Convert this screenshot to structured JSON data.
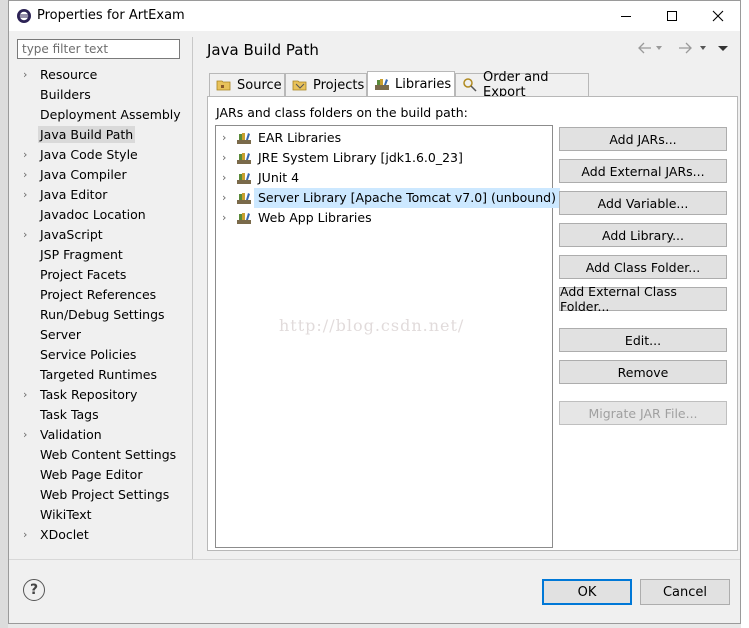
{
  "window": {
    "title": "Properties for ArtExam"
  },
  "filter": {
    "placeholder": "type filter text"
  },
  "nav": [
    {
      "label": "Resource",
      "expandable": true
    },
    {
      "label": "Builders",
      "expandable": false
    },
    {
      "label": "Deployment Assembly",
      "expandable": false
    },
    {
      "label": "Java Build Path",
      "expandable": false,
      "selected": true
    },
    {
      "label": "Java Code Style",
      "expandable": true
    },
    {
      "label": "Java Compiler",
      "expandable": true
    },
    {
      "label": "Java Editor",
      "expandable": true
    },
    {
      "label": "Javadoc Location",
      "expandable": false
    },
    {
      "label": "JavaScript",
      "expandable": true
    },
    {
      "label": "JSP Fragment",
      "expandable": false
    },
    {
      "label": "Project Facets",
      "expandable": false
    },
    {
      "label": "Project References",
      "expandable": false
    },
    {
      "label": "Run/Debug Settings",
      "expandable": false
    },
    {
      "label": "Server",
      "expandable": false
    },
    {
      "label": "Service Policies",
      "expandable": false
    },
    {
      "label": "Targeted Runtimes",
      "expandable": false
    },
    {
      "label": "Task Repository",
      "expandable": true
    },
    {
      "label": "Task Tags",
      "expandable": false
    },
    {
      "label": "Validation",
      "expandable": true
    },
    {
      "label": "Web Content Settings",
      "expandable": false
    },
    {
      "label": "Web Page Editor",
      "expandable": false
    },
    {
      "label": "Web Project Settings",
      "expandable": false
    },
    {
      "label": "WikiText",
      "expandable": false
    },
    {
      "label": "XDoclet",
      "expandable": true
    }
  ],
  "page": {
    "title": "Java Build Path"
  },
  "tabs": [
    {
      "label": "Source"
    },
    {
      "label": "Projects"
    },
    {
      "label": "Libraries",
      "active": true
    },
    {
      "label": "Order and Export"
    }
  ],
  "libraries": {
    "heading": "JARs and class folders on the build path:",
    "items": [
      {
        "label": "EAR Libraries"
      },
      {
        "label": "JRE System Library [jdk1.6.0_23]"
      },
      {
        "label": "JUnit 4"
      },
      {
        "label": "Server Library [Apache Tomcat v7.0] (unbound)",
        "selected": true
      },
      {
        "label": "Web App Libraries"
      }
    ]
  },
  "buttons": {
    "add_jars": "Add JARs...",
    "add_external_jars": "Add External JARs...",
    "add_variable": "Add Variable...",
    "add_library": "Add Library...",
    "add_class_folder": "Add Class Folder...",
    "add_external_class_folder": "Add External Class Folder...",
    "edit": "Edit...",
    "remove": "Remove",
    "migrate_jar": "Migrate JAR File..."
  },
  "footer": {
    "ok": "OK",
    "cancel": "Cancel",
    "help": "?"
  },
  "watermark": "http://blog.csdn.net/",
  "colors": {
    "selection": "#cce8ff",
    "nav_selection": "#d9d9d9",
    "ok_border": "#0078d7"
  }
}
